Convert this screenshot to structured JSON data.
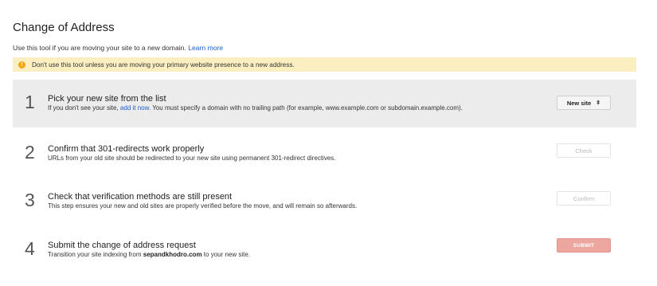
{
  "page": {
    "title": "Change of Address",
    "intro_text": "Use this tool if you are moving your site to a new domain.",
    "learn_more": "Learn more"
  },
  "warning": {
    "icon": "warning-icon",
    "icon_glyph": "!",
    "text": "Don't use this tool unless you are moving your primary website presence to a new address."
  },
  "steps": [
    {
      "number": "1",
      "heading": "Pick your new site from the list",
      "desc_before": "If you don't see your site,",
      "desc_link": "add it now.",
      "desc_after": "You must specify a domain with no trailing path (for example, www.example.com or subdomain.example.com).",
      "control_label": "New site",
      "control_icon": "chevron-updown-icon",
      "control_glyph": "⬍"
    },
    {
      "number": "2",
      "heading": "Confirm that 301-redirects work properly",
      "desc": "URLs from your old site should be redirected to your new site using permanent 301-redirect directives.",
      "control_label": "Check"
    },
    {
      "number": "3",
      "heading": "Check that verification methods are still present",
      "desc": "This step ensures your new and old sites are properly verified before the move, and will remain so afterwards.",
      "control_label": "Confirm"
    },
    {
      "number": "4",
      "heading": "Submit the change of address request",
      "desc_before": "Transition your site indexing from",
      "desc_bold": "sepandkhodro.com",
      "desc_after": "to your new site.",
      "control_label": "SUBMIT"
    }
  ],
  "colors": {
    "link": "#1a5fc7",
    "warning_bg": "#fbefc2",
    "warning_icon": "#f2a51a",
    "active_step_bg": "#ececec",
    "submit_bg": "#eba79f"
  }
}
